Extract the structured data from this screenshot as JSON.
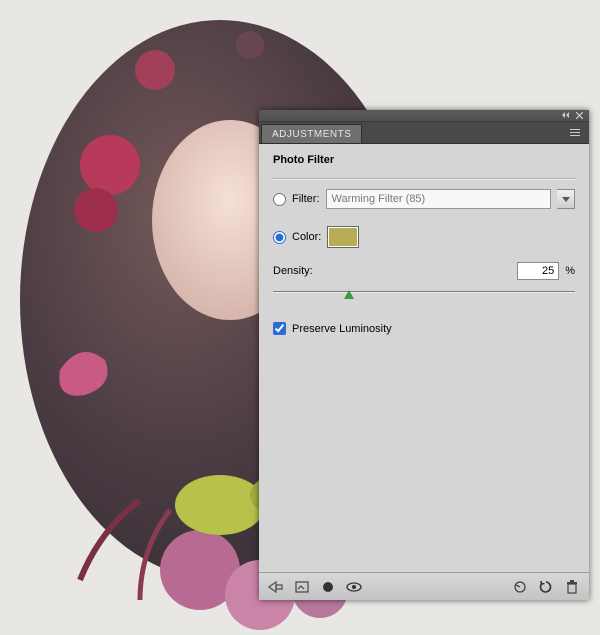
{
  "panel": {
    "tab_label": "ADJUSTMENTS",
    "title": "Photo Filter",
    "filter": {
      "radio_label": "Filter:",
      "selected": "Warming Filter (85)",
      "checked": false
    },
    "color": {
      "radio_label": "Color:",
      "swatch_hex": "#b7ad55",
      "checked": true
    },
    "density": {
      "label": "Density:",
      "value": "25",
      "unit": "%",
      "percent_pos": 25
    },
    "preserve": {
      "label": "Preserve Luminosity",
      "checked": true
    }
  }
}
